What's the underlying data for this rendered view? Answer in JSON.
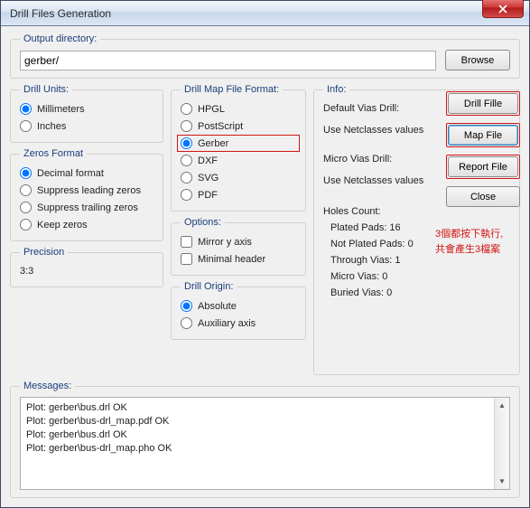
{
  "window": {
    "title": "Drill Files Generation"
  },
  "output": {
    "legend": "Output directory:",
    "value": "gerber/",
    "browse": "Browse"
  },
  "drillUnits": {
    "legend": "Drill Units:",
    "options": {
      "mm": "Millimeters",
      "in": "Inches"
    }
  },
  "zerosFormat": {
    "legend": "Zeros Format",
    "options": {
      "decimal": "Decimal format",
      "supLead": "Suppress leading zeros",
      "supTrail": "Suppress trailing zeros",
      "keep": "Keep zeros"
    }
  },
  "precision": {
    "legend": "Precision",
    "value": "3:3"
  },
  "mapFormat": {
    "legend": "Drill Map File Format:",
    "options": {
      "hpgl": "HPGL",
      "ps": "PostScript",
      "gerber": "Gerber",
      "dxf": "DXF",
      "svg": "SVG",
      "pdf": "PDF"
    }
  },
  "options": {
    "legend": "Options:",
    "mirror": "Mirror y axis",
    "minhdr": "Minimal header"
  },
  "origin": {
    "legend": "Drill Origin:",
    "abs": "Absolute",
    "aux": "Auxiliary axis"
  },
  "info": {
    "legend": "Info:",
    "defVias": "Default Vias Drill:",
    "useNet1": "Use Netclasses values",
    "microVias": "Micro Vias Drill:",
    "useNet2": "Use Netclasses values",
    "holesHeader": "Holes Count:",
    "plated": "Plated Pads: 16",
    "notPlated": "Not Plated Pads: 0",
    "through": "Through Vias: 1",
    "micro": "Micro Vias: 0",
    "buried": "Buried Vias: 0"
  },
  "buttons": {
    "drill": "Drill Fille",
    "map": "Map File",
    "report": "Report File",
    "close": "Close"
  },
  "annotation": {
    "line1": "3個都按下執行,",
    "line2": "共會產生3檔案"
  },
  "messages": {
    "legend": "Messages:",
    "text": "Plot: gerber\\bus.drl OK\nPlot: gerber\\bus-drl_map.pdf OK\nPlot: gerber\\bus.drl OK\nPlot: gerber\\bus-drl_map.pho OK"
  }
}
